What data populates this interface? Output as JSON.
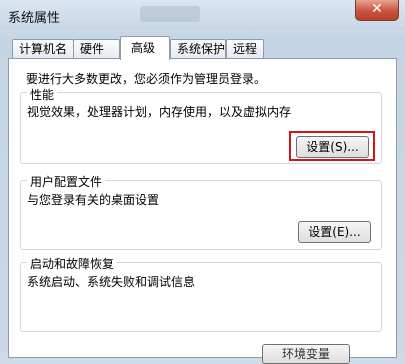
{
  "window": {
    "title": "系统属性",
    "close_glyph": "✕"
  },
  "tabs": [
    "计算机名",
    "硬件",
    "高级",
    "系统保护",
    "远程"
  ],
  "intro": "要进行大多数更改，您必须作为管理员登录。",
  "performance": {
    "title": "性能",
    "description": "视觉效果，处理器计划，内存使用，以及虚拟内存",
    "button": "设置(S)..."
  },
  "user_profiles": {
    "title": "用户配置文件",
    "description": "与您登录有关的桌面设置",
    "button": "设置(E)..."
  },
  "startup_recovery": {
    "title": "启动和故障恢复",
    "description": "系统启动、系统失败和调试信息"
  },
  "bottom_button": "环境变量"
}
